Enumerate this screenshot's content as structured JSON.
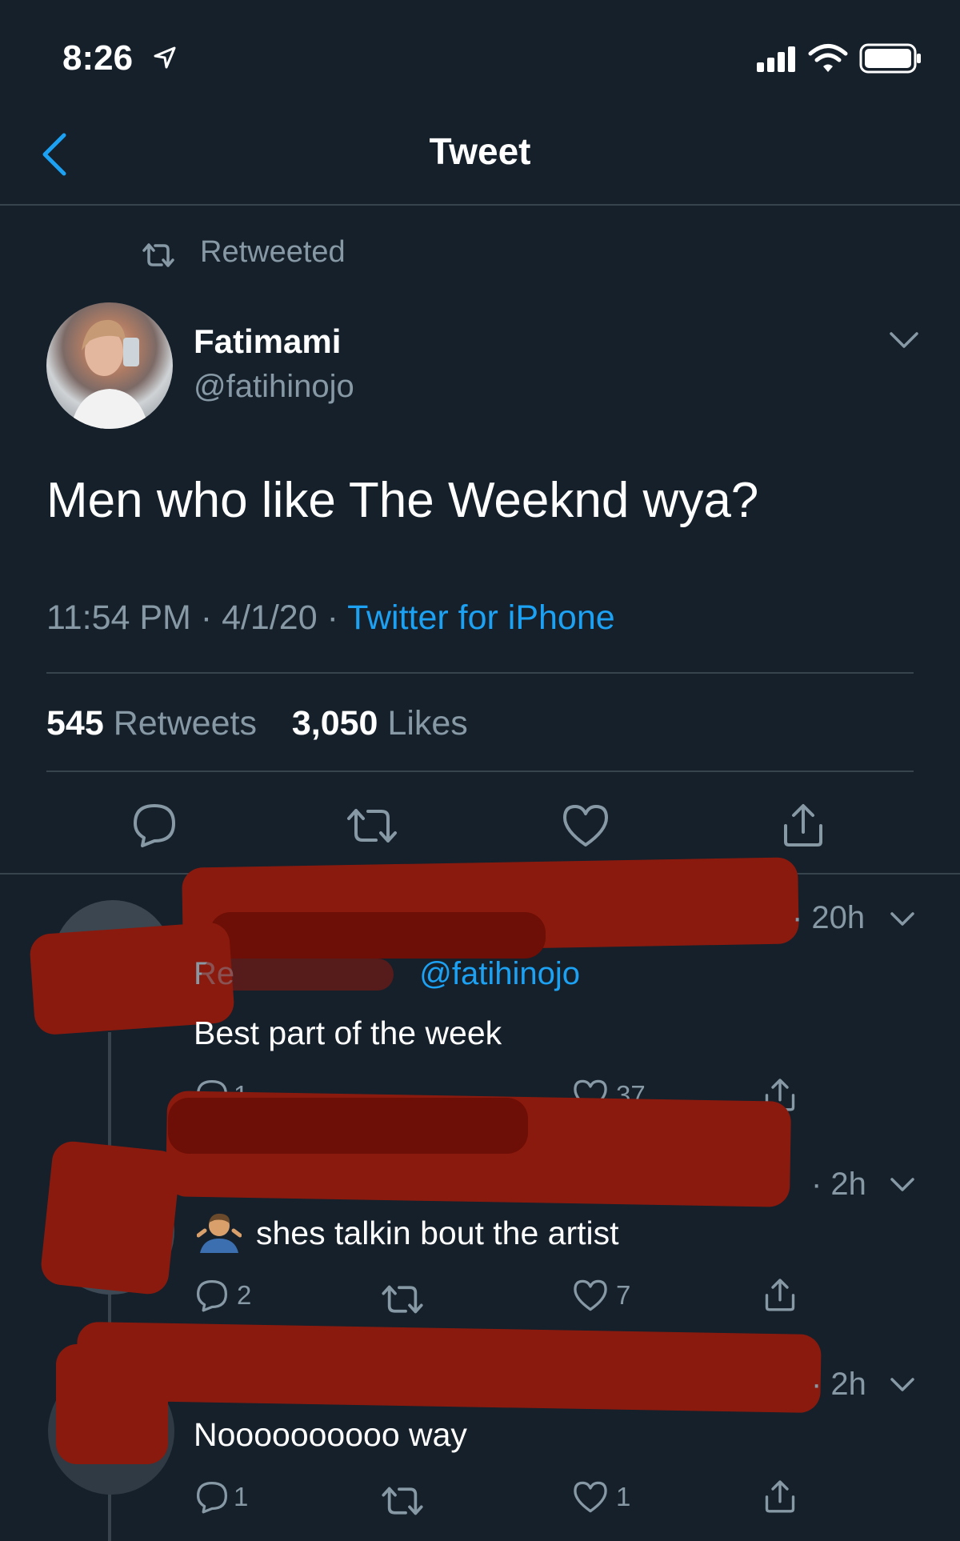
{
  "status_bar": {
    "time": "8:26"
  },
  "nav": {
    "title": "Tweet"
  },
  "retweet_label": "Retweeted",
  "tweet": {
    "author_name": "Fatimami",
    "author_handle": "@fatihinojo",
    "text": "Men who like The Weeknd wya?",
    "time_date": "11:54 PM · 4/1/20 ·",
    "source": "Twitter for iPhone",
    "retweet_count": "545",
    "retweet_label": "Retweets",
    "like_count": "3,050",
    "like_label": "Likes"
  },
  "replies": [
    {
      "time": "· 20h",
      "replying_to_prefix": "Re",
      "replying_to_handle": "@fatihinojo",
      "text": "Best part of the week",
      "reply_count": "1",
      "retweet_count": "",
      "like_count": "37"
    },
    {
      "time": "· 2h",
      "text": "shes talkin bout the artist",
      "emoji": "man-shrugging",
      "reply_count": "2",
      "retweet_count": "",
      "like_count": "7"
    },
    {
      "time": "· 2h",
      "text": "Noooooooooo way",
      "reply_count": "1",
      "retweet_count": "",
      "like_count": "1"
    }
  ],
  "icons": [
    "back-chevron-icon",
    "signal-icon",
    "wifi-icon",
    "battery-icon",
    "location-arrow-icon",
    "retweet-icon",
    "chevron-down-icon",
    "reply-icon",
    "like-icon",
    "share-icon"
  ],
  "colors": {
    "background": "#15202b",
    "accent": "#1da1f2",
    "muted": "#8899a6",
    "divider": "#38444d",
    "redaction": "#8b1a0e"
  }
}
